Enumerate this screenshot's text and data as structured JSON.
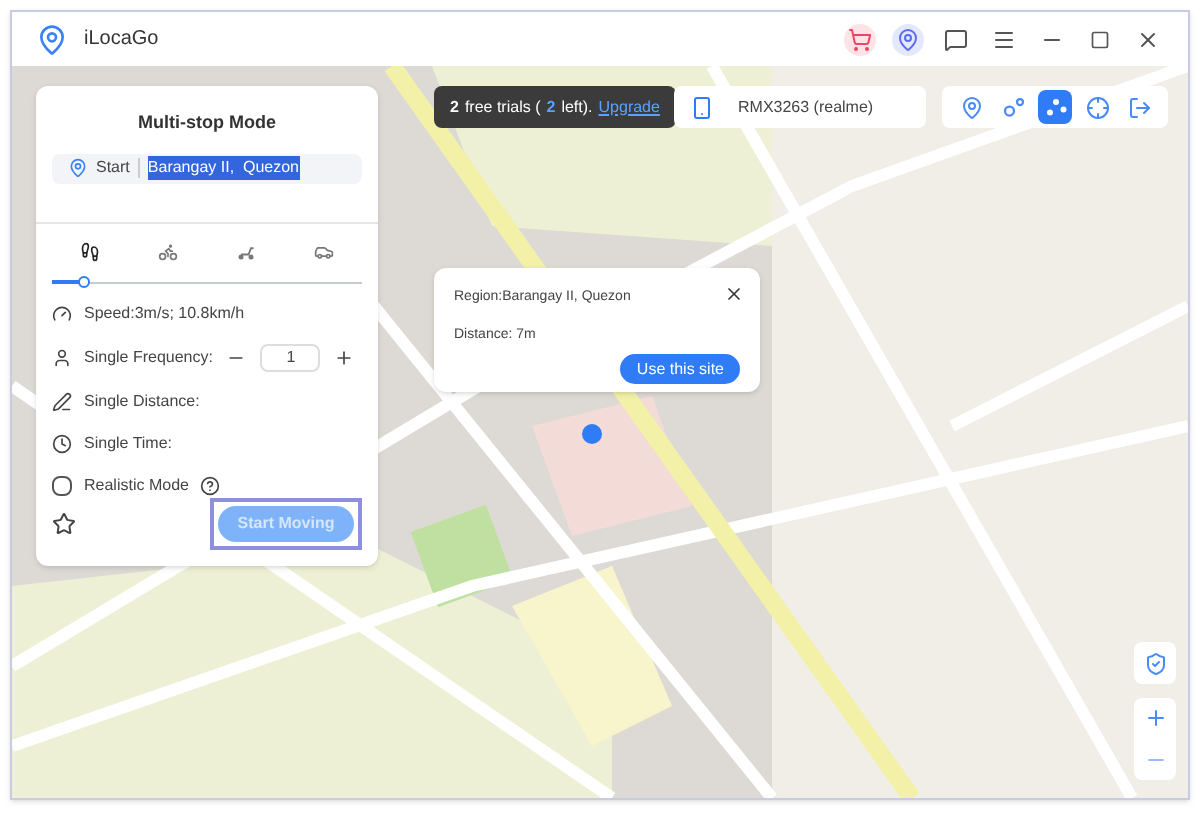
{
  "window": {
    "title": "iLocaGo"
  },
  "trial_banner": {
    "count": "2",
    "text": "free trials (",
    "left_count": "2",
    "left_text": "left).",
    "link": "Upgrade"
  },
  "device": {
    "name": "RMX3263 (realme)"
  },
  "mode_tools": [
    {
      "kind": "teleport",
      "selected": false
    },
    {
      "kind": "two-spot",
      "selected": false
    },
    {
      "kind": "multi-spot",
      "selected": true
    },
    {
      "kind": "joystick",
      "selected": false
    },
    {
      "kind": "exit",
      "selected": false
    }
  ],
  "panel": {
    "title": "Multi-stop Mode",
    "start_label": "Start",
    "start_value": "Barangay II,  Quezon",
    "start_value_highlighted": true,
    "transports": [
      {
        "kind": "walk",
        "selected": true
      },
      {
        "kind": "bike",
        "selected": false
      },
      {
        "kind": "scooter",
        "selected": false
      },
      {
        "kind": "car",
        "selected": false
      }
    ],
    "speed": {
      "level": 0.1,
      "reading": "Speed:3m/s; 10.8km/h"
    },
    "frequency": {
      "label": "Single Frequency:",
      "value": "1"
    },
    "distance_label": "Single Distance:",
    "time_label": "Single Time:",
    "realistic": {
      "label": "Realistic Mode",
      "checked": false
    },
    "start_button": {
      "label": "Start Moving",
      "disabled": true
    }
  },
  "popup": {
    "region": "Region:Barangay II, Quezon",
    "distance": "Distance: 7m",
    "button": "Use this site"
  }
}
